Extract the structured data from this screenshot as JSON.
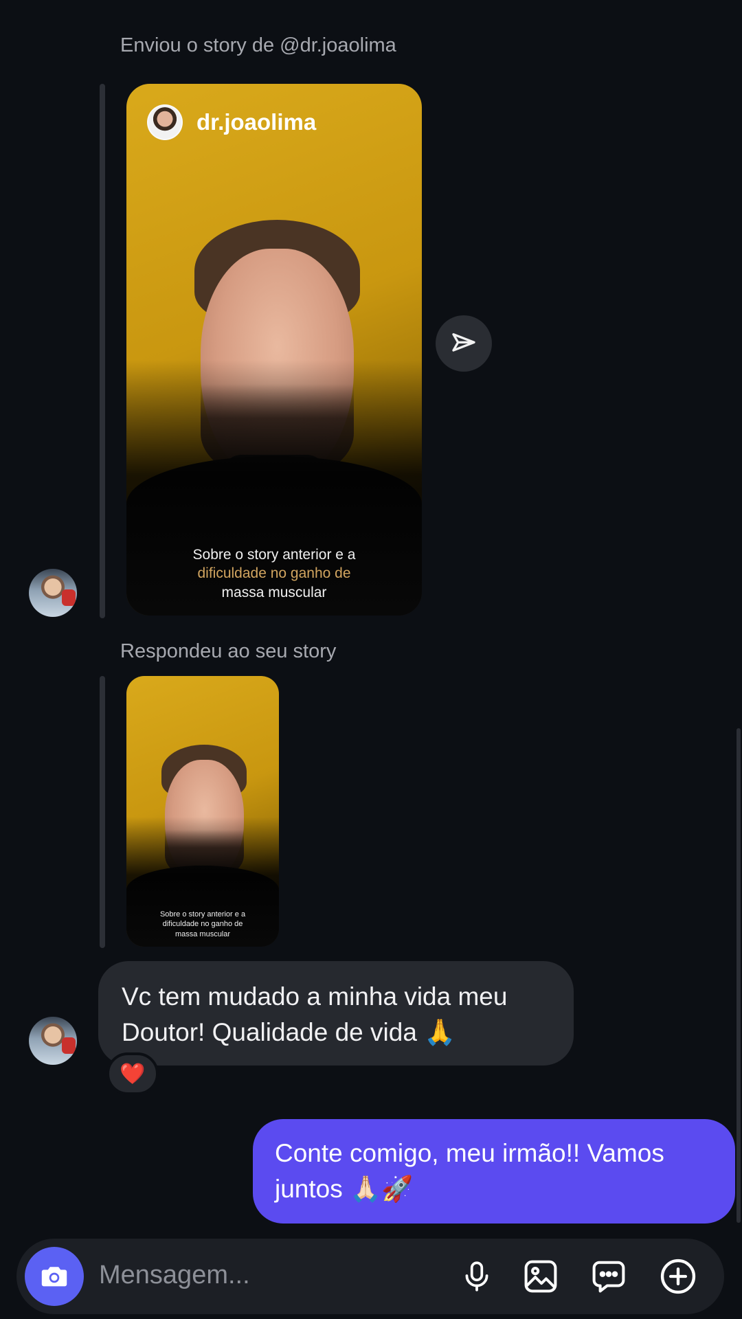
{
  "conversation": {
    "story_share": {
      "label": "Enviou o story de @dr.joaolima",
      "story_username": "dr.joaolima",
      "caption_line1": "Sobre o story anterior e a",
      "caption_line2_highlight": "dificuldade no ganho de",
      "caption_line3": "massa muscular"
    },
    "story_reply": {
      "label": "Respondeu ao seu story",
      "caption_line1": "Sobre o story anterior e a",
      "caption_line2": "dificuldade no ganho de",
      "caption_line3": "massa muscular"
    },
    "incoming_message": {
      "text": "Vc tem mudado a minha vida meu Doutor! Qualidade de vida 🙏",
      "reaction": "❤️"
    },
    "outgoing_message": {
      "text": "Conte comigo, meu irmão!! Vamos juntos 🙏🏻🚀"
    }
  },
  "composer": {
    "placeholder": "Mensagem...",
    "accent_color": "#5b61f3",
    "icons": [
      "camera-icon",
      "microphone-icon",
      "gallery-icon",
      "sticker-chat-icon",
      "add-icon"
    ]
  },
  "colors": {
    "background": "#0c0f14",
    "incoming_bubble": "#26292f",
    "outgoing_bubble": "#5b4bf0"
  }
}
